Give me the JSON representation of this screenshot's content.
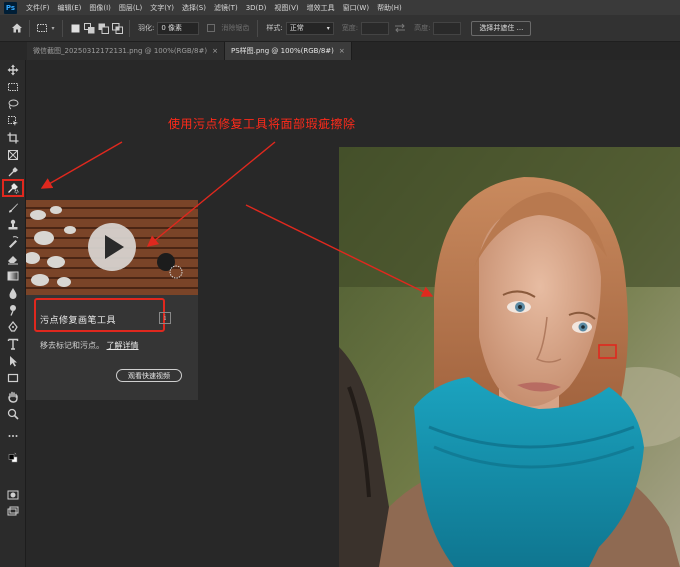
{
  "app": {
    "logo": "Ps"
  },
  "menu": [
    "文件(F)",
    "编辑(E)",
    "图像(I)",
    "图层(L)",
    "文字(Y)",
    "选择(S)",
    "滤镜(T)",
    "3D(D)",
    "视图(V)",
    "增效工具",
    "窗口(W)",
    "帮助(H)"
  ],
  "options": {
    "feather_label": "羽化:",
    "feather_value": "0 像素",
    "antialias_label": "消除锯齿",
    "style_label": "样式:",
    "style_value": "正常",
    "width_label": "宽度:",
    "height_label": "高度:",
    "select_mask_button": "选择并遮住 ..."
  },
  "tabs": [
    {
      "title": "微信截图_20250312172131.png @ 100%(RGB/8#)",
      "close": "×",
      "active": false
    },
    {
      "title": "PS样图.png @ 100%(RGB/8#)",
      "close": "×",
      "active": true
    }
  ],
  "tooltip": {
    "tool_name": "污点修复画笔工具",
    "info_glyph": "i",
    "description": "移去标记和污点。",
    "learn_more": "了解详情",
    "watch_video": "观看快速视频"
  },
  "annotation": {
    "text": "使用污点修复工具将面部瑕疵擦除",
    "color": "#ff2a1a"
  },
  "colors": {
    "accent_red": "#e0281e",
    "ps_blue": "#31a8ff",
    "ui_dark": "#282828"
  },
  "toolbar_icons": [
    "move-icon",
    "marquee-icon",
    "lasso-icon",
    "object-select-icon",
    "crop-icon",
    "frame-icon",
    "eyedropper-icon",
    "spot-healing-brush-icon",
    "brush-icon",
    "clone-stamp-icon",
    "history-brush-icon",
    "eraser-icon",
    "gradient-icon",
    "blur-icon",
    "dodge-icon",
    "pen-icon",
    "type-icon",
    "path-select-icon",
    "rectangle-icon",
    "hand-icon",
    "zoom-icon",
    "more-tools-icon",
    "color-swatches-icon",
    "quick-mask-icon",
    "screen-mode-icon"
  ]
}
